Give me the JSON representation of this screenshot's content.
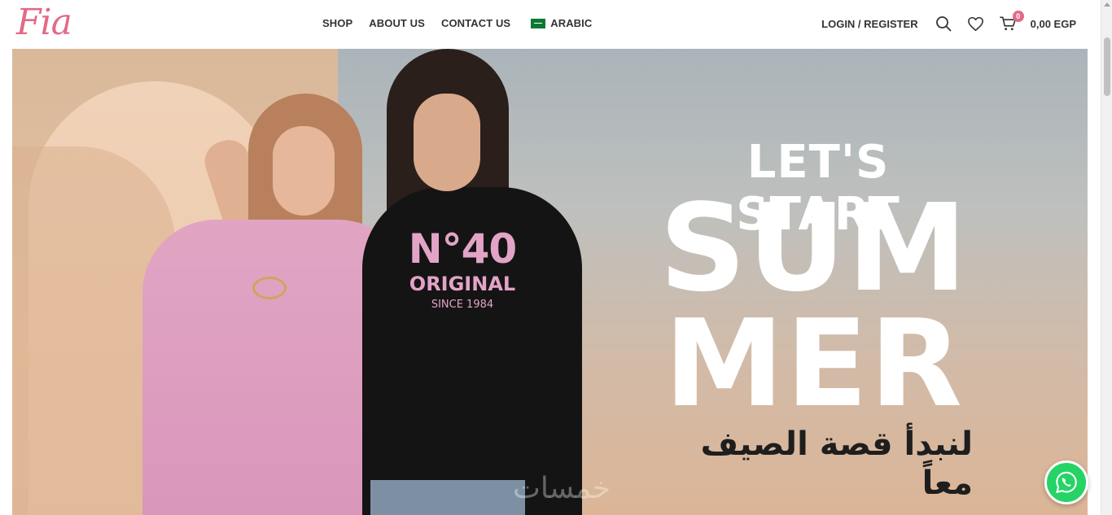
{
  "header": {
    "logo_text": "Fia",
    "nav": [
      {
        "label": "SHOP"
      },
      {
        "label": "ABOUT US"
      },
      {
        "label": "CONTACT US"
      }
    ],
    "language_label": "ARABIC",
    "login_label": "LOGIN / REGISTER",
    "cart_count": "0",
    "cart_total": "0,00 EGP",
    "accent_color": "#e26a86"
  },
  "hero": {
    "headline_line1": "LET'S START",
    "headline_line2": "SUM",
    "headline_line3": "MER",
    "arabic_tagline": "لنبدأ قصة الصيف معاً",
    "hoodie_print_big": "N°40",
    "hoodie_print_mid": "ORIGINAL",
    "hoodie_print_small": "SINCE 1984",
    "watermark_text": "خمسات"
  },
  "icons": [
    "search-icon",
    "heart-icon",
    "cart-icon",
    "whatsapp-icon",
    "saudi-flag-icon"
  ]
}
